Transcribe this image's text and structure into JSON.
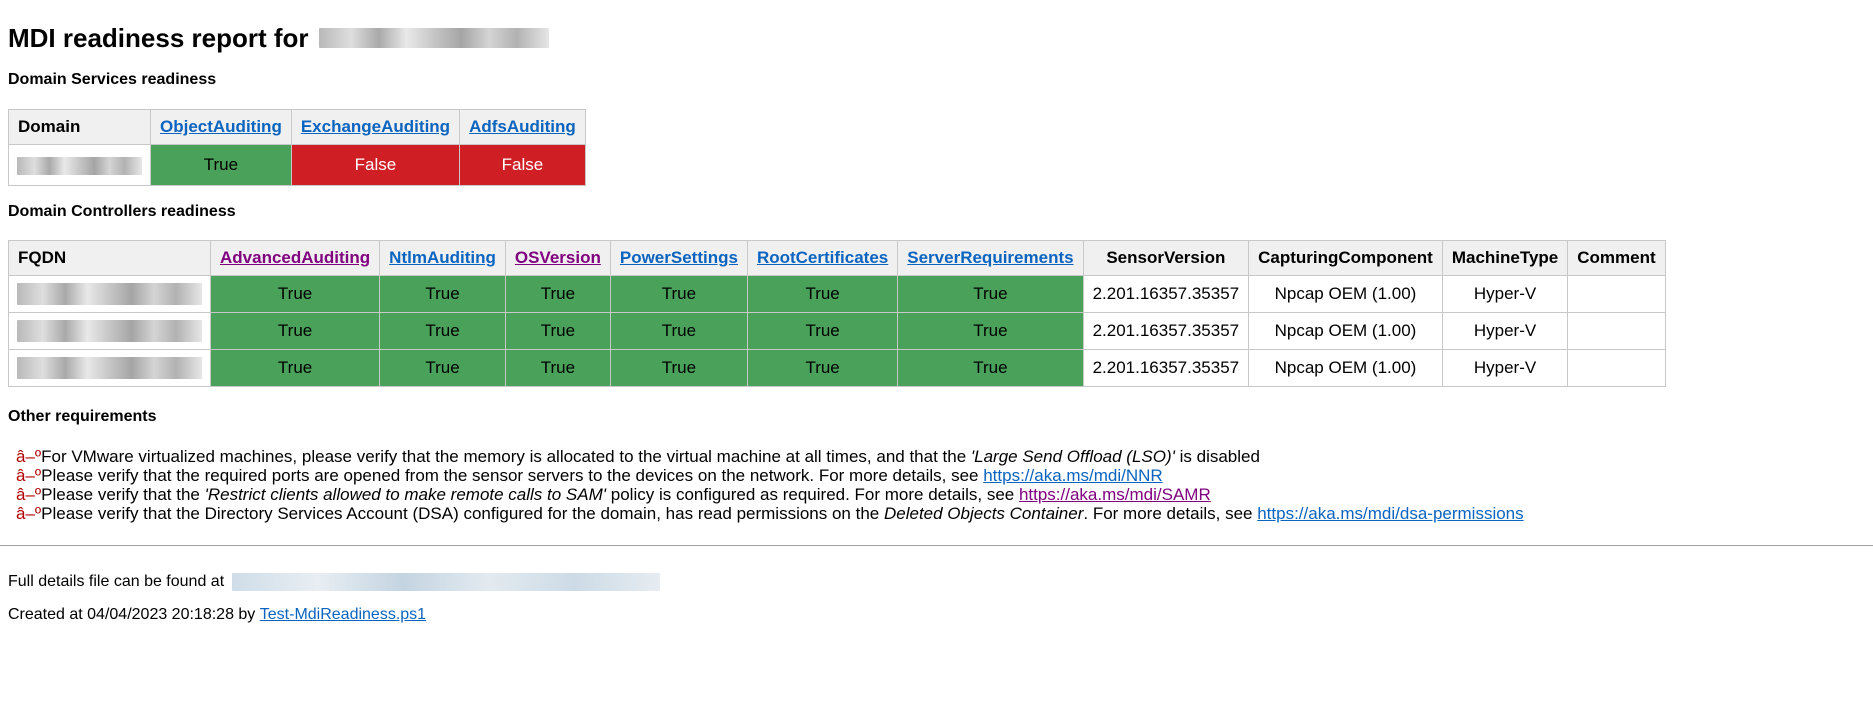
{
  "report": {
    "title_prefix": "MDI readiness report for"
  },
  "domain_services": {
    "heading": "Domain Services readiness",
    "headers": {
      "domain": "Domain",
      "object_auditing": "ObjectAuditing",
      "exchange_auditing": "ExchangeAuditing",
      "adfs_auditing": "AdfsAuditing"
    },
    "row": {
      "object_auditing": "True",
      "exchange_auditing": "False",
      "adfs_auditing": "False"
    }
  },
  "domain_controllers": {
    "heading": "Domain Controllers readiness",
    "headers": {
      "fqdn": "FQDN",
      "advanced_auditing": "AdvancedAuditing",
      "ntlm_auditing": "NtlmAuditing",
      "os_version": "OSVersion",
      "power_settings": "PowerSettings",
      "root_certificates": "RootCertificates",
      "server_requirements": "ServerRequirements",
      "sensor_version": "SensorVersion",
      "capturing_component": "CapturingComponent",
      "machine_type": "MachineType",
      "comment": "Comment"
    },
    "rows": [
      {
        "advanced_auditing": "True",
        "ntlm_auditing": "True",
        "os_version": "True",
        "power_settings": "True",
        "root_certificates": "True",
        "server_requirements": "True",
        "sensor_version": "2.201.16357.35357",
        "capturing_component": "Npcap OEM (1.00)",
        "machine_type": "Hyper-V",
        "comment": ""
      },
      {
        "advanced_auditing": "True",
        "ntlm_auditing": "True",
        "os_version": "True",
        "power_settings": "True",
        "root_certificates": "True",
        "server_requirements": "True",
        "sensor_version": "2.201.16357.35357",
        "capturing_component": "Npcap OEM (1.00)",
        "machine_type": "Hyper-V",
        "comment": ""
      },
      {
        "advanced_auditing": "True",
        "ntlm_auditing": "True",
        "os_version": "True",
        "power_settings": "True",
        "root_certificates": "True",
        "server_requirements": "True",
        "sensor_version": "2.201.16357.35357",
        "capturing_component": "Npcap OEM (1.00)",
        "machine_type": "Hyper-V",
        "comment": ""
      }
    ]
  },
  "other_requirements": {
    "heading": "Other requirements",
    "bullet": "â–º",
    "items": [
      {
        "text_before": "For VMware virtualized machines, please verify that the memory is allocated to the virtual machine at all times, and that the ",
        "emphasis": "'Large Send Offload (LSO)'",
        "text_after": " is disabled",
        "link": ""
      },
      {
        "text_before": "Please verify that the required ports are opened from the sensor servers to the devices on the network. For more details, see ",
        "emphasis": "",
        "text_after": "",
        "link": "https://aka.ms/mdi/NNR"
      },
      {
        "text_before": "Please verify that the ",
        "emphasis": "'Restrict clients allowed to make remote calls to SAM'",
        "text_after": " policy is configured as required. For more details, see ",
        "link": "https://aka.ms/mdi/SAMR"
      },
      {
        "text_before": "Please verify that the Directory Services Account (DSA) configured for the domain, has read permissions on the ",
        "emphasis": "Deleted Objects Container",
        "text_after": ". For more details, see ",
        "link": "https://aka.ms/mdi/dsa-permissions"
      }
    ]
  },
  "footer": {
    "full_details_label": "Full details file can be found at",
    "created_prefix": "Created at 04/04/2023 20:18:28 by",
    "script_link": "Test-MdiReadiness.ps1"
  }
}
